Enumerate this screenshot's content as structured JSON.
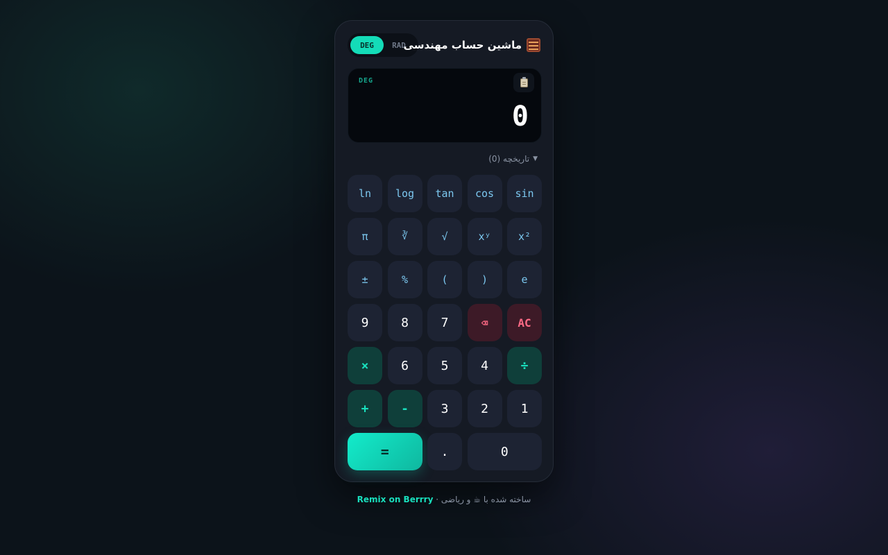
{
  "app": {
    "title": "ماشین حساب مهندسی",
    "title_icon": "abacus-icon"
  },
  "mode_toggle": {
    "options": [
      "DEG",
      "RAD"
    ],
    "selected": "DEG"
  },
  "display": {
    "mode_label": "DEG",
    "value": "0",
    "copy_icon": "clipboard-icon"
  },
  "history": {
    "label": "تاریخچه (0)",
    "chevron": "▼"
  },
  "keys": [
    {
      "label": "sin",
      "type": "fn"
    },
    {
      "label": "cos",
      "type": "fn"
    },
    {
      "label": "tan",
      "type": "fn"
    },
    {
      "label": "log",
      "type": "fn"
    },
    {
      "label": "ln",
      "type": "fn"
    },
    {
      "label": "x²",
      "type": "fn"
    },
    {
      "label": "xʸ",
      "type": "fn"
    },
    {
      "label": "√",
      "type": "fn"
    },
    {
      "label": "∛",
      "type": "fn"
    },
    {
      "label": "π",
      "type": "fn"
    },
    {
      "label": "e",
      "type": "fn"
    },
    {
      "label": ")",
      "type": "fn"
    },
    {
      "label": "(",
      "type": "fn"
    },
    {
      "label": "%",
      "type": "fn"
    },
    {
      "label": "±",
      "type": "fn"
    },
    {
      "label": "AC",
      "type": "danger"
    },
    {
      "label": "⌫",
      "type": "danger"
    },
    {
      "label": "7",
      "type": "num"
    },
    {
      "label": "8",
      "type": "num"
    },
    {
      "label": "9",
      "type": "num"
    },
    {
      "label": "÷",
      "type": "op"
    },
    {
      "label": "4",
      "type": "num"
    },
    {
      "label": "5",
      "type": "num"
    },
    {
      "label": "6",
      "type": "num"
    },
    {
      "label": "×",
      "type": "op"
    },
    {
      "label": "1",
      "type": "num"
    },
    {
      "label": "2",
      "type": "num"
    },
    {
      "label": "3",
      "type": "num"
    },
    {
      "label": "-",
      "type": "op"
    },
    {
      "label": "+",
      "type": "op"
    },
    {
      "label": "0",
      "type": "num"
    },
    {
      "label": ".",
      "type": "num"
    },
    {
      "label": "=",
      "type": "equals"
    }
  ],
  "footer": {
    "text": "ساخته شده با ☕ و ریاضی ·",
    "link": "Remix on Berrry"
  },
  "colors": {
    "accent": "#14dcb8",
    "danger": "#ff6b86",
    "function_text": "#7cc8f0",
    "panel": "#151a24"
  }
}
